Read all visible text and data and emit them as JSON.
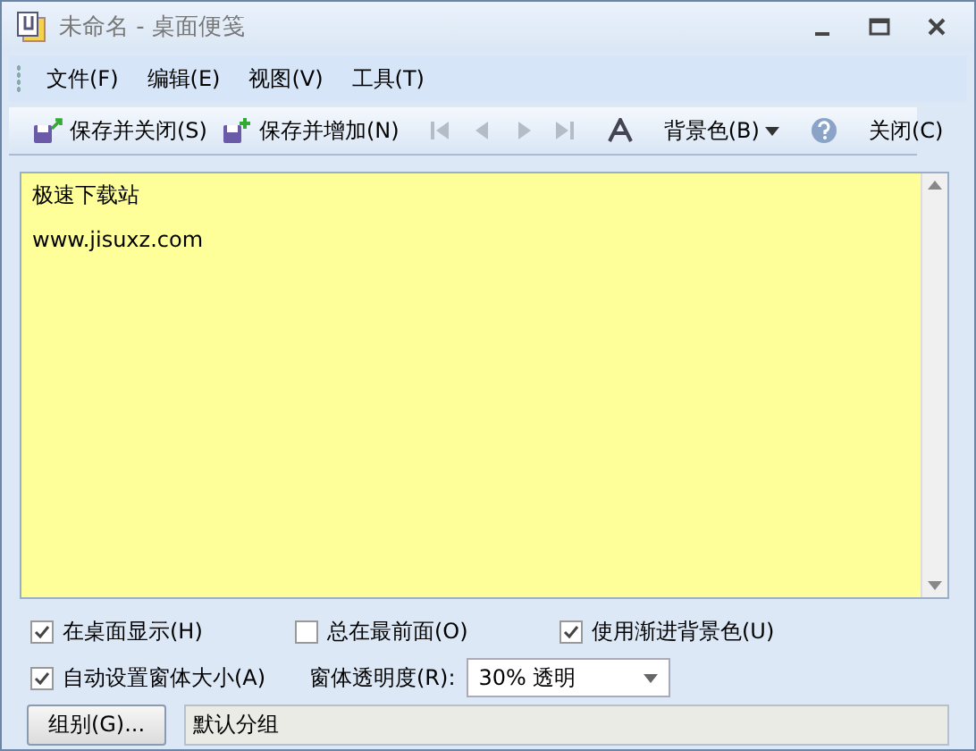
{
  "window": {
    "title": "未命名 - 桌面便笺"
  },
  "menu": [
    {
      "label": "文件(F)"
    },
    {
      "label": "编辑(E)"
    },
    {
      "label": "视图(V)"
    },
    {
      "label": "工具(T)"
    }
  ],
  "toolbar": {
    "save_close": {
      "label": "保存并关闭(S)"
    },
    "save_add": {
      "label": "保存并增加(N)"
    },
    "navigation": [
      {
        "kind": "first",
        "disabled": true
      },
      {
        "kind": "previous",
        "disabled": true
      },
      {
        "kind": "next",
        "disabled": true
      },
      {
        "kind": "last",
        "disabled": true
      }
    ],
    "background_color": {
      "label": "背景色(B)"
    },
    "close": {
      "label": "关闭(C)"
    }
  },
  "note": {
    "lines": [
      "极速下载站",
      "www.jisuxz.com"
    ]
  },
  "options": [
    {
      "label": "在桌面显示(H)",
      "checked": true
    },
    {
      "label": "总在最前面(O)",
      "checked": false
    },
    {
      "label": "使用渐进背景色(U)",
      "checked": true
    },
    {
      "label": "自动设置窗体大小(A)",
      "checked": true
    }
  ],
  "opacity": {
    "label": "窗体透明度(R):",
    "value": "30% 透明"
  },
  "group": {
    "button": "组别(G)...",
    "value": "默认分组"
  }
}
